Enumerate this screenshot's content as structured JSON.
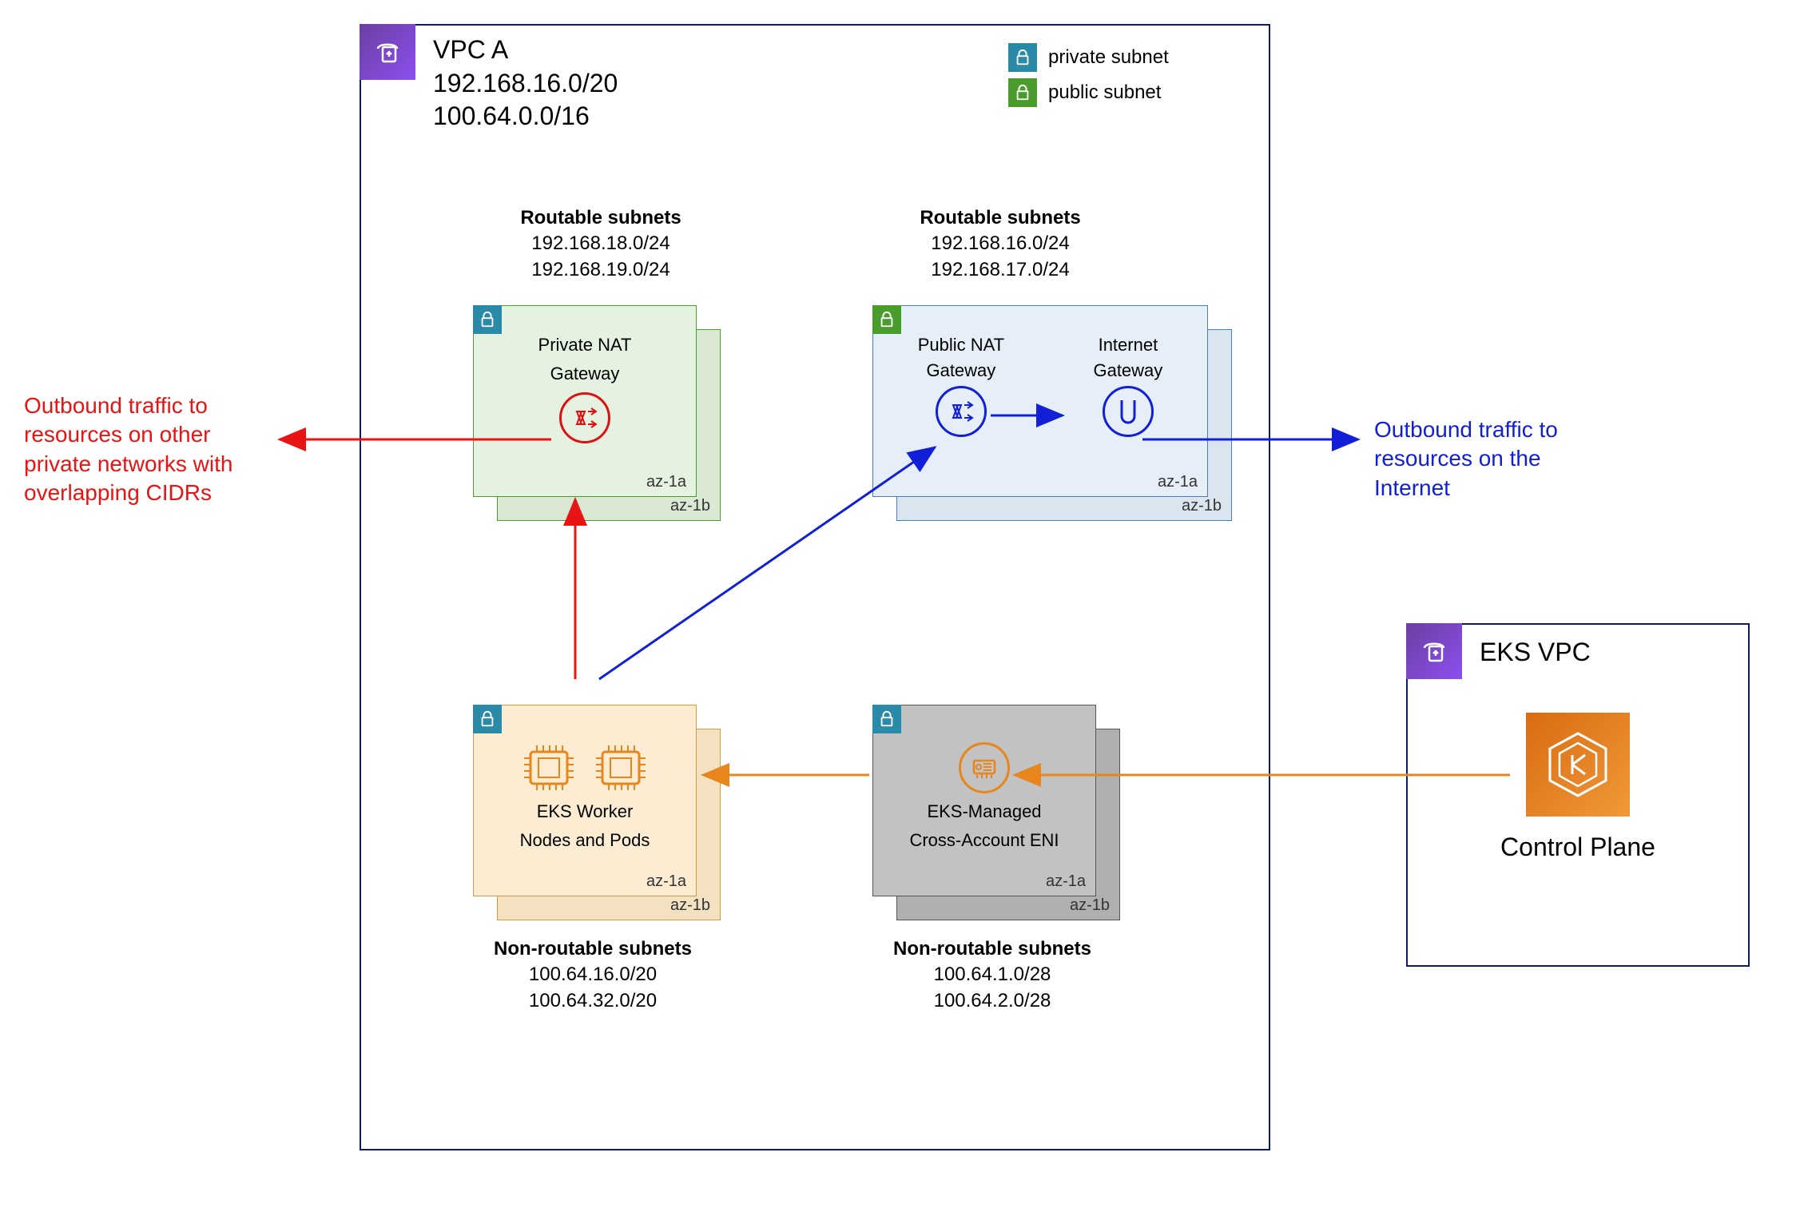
{
  "vpc_a": {
    "title_line1": "VPC A",
    "title_line2": "192.168.16.0/20",
    "title_line3": "100.64.0.0/16",
    "legend": {
      "private": "private subnet",
      "public": "public subnet"
    },
    "routable_left": {
      "head": "Routable subnets",
      "l1": "192.168.18.0/24",
      "l2": "192.168.19.0/24"
    },
    "routable_right": {
      "head": "Routable subnets",
      "l1": "192.168.16.0/24",
      "l2": "192.168.17.0/24"
    },
    "nonroutable_left": {
      "head": "Non-routable subnets",
      "l1": "100.64.16.0/20",
      "l2": "100.64.32.0/20"
    },
    "nonroutable_right": {
      "head": "Non-routable subnets",
      "l1": "100.64.1.0/28",
      "l2": "100.64.2.0/28"
    },
    "private_nat": {
      "title": "Private NAT",
      "sub": "Gateway"
    },
    "public_nat": {
      "title": "Public NAT",
      "sub": "Gateway"
    },
    "igw": {
      "title": "Internet",
      "sub": "Gateway"
    },
    "eks_nodes": {
      "l1": "EKS Worker",
      "l2": "Nodes and Pods"
    },
    "eni": {
      "l1": "EKS-Managed",
      "l2": "Cross-Account ENI"
    },
    "az1a": "az-1a",
    "az1b": "az-1b"
  },
  "annotations": {
    "left": "Outbound traffic to resources on other private networks with overlapping CIDRs",
    "right": "Outbound traffic to resources on the Internet"
  },
  "eks_vpc": {
    "title": "EKS VPC",
    "cp": "Control Plane"
  }
}
